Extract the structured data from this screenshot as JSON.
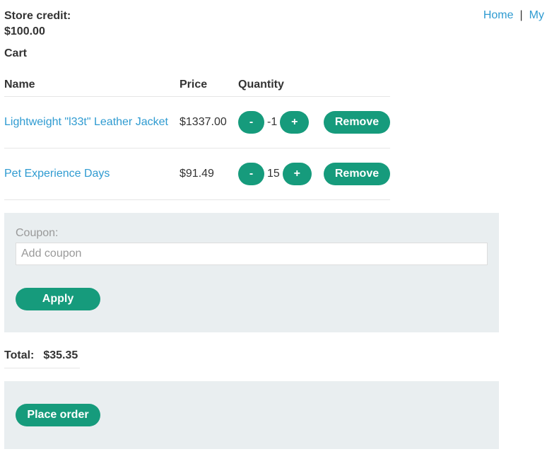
{
  "header": {
    "store_credit_label": "Store credit:",
    "store_credit_value": "$100.00",
    "nav": {
      "home": "Home",
      "separator": "|",
      "my": "My"
    }
  },
  "cart": {
    "heading": "Cart",
    "columns": {
      "name": "Name",
      "price": "Price",
      "quantity": "Quantity"
    },
    "items": [
      {
        "name": "Lightweight \"l33t\" Leather Jacket",
        "price": "$1337.00",
        "quantity": "-1",
        "decrement_label": "-",
        "increment_label": "+",
        "remove_label": "Remove"
      },
      {
        "name": "Pet Experience Days",
        "price": "$91.49",
        "quantity": "15",
        "decrement_label": "-",
        "increment_label": "+",
        "remove_label": "Remove"
      }
    ]
  },
  "coupon": {
    "label": "Coupon:",
    "placeholder": "Add coupon",
    "value": "",
    "apply_label": "Apply"
  },
  "total": {
    "label": "Total:",
    "value": "$35.35"
  },
  "order": {
    "place_order_label": "Place order"
  },
  "colors": {
    "accent_button": "#169b7c",
    "link": "#2f9bd1",
    "panel_background": "#e9eef0"
  }
}
